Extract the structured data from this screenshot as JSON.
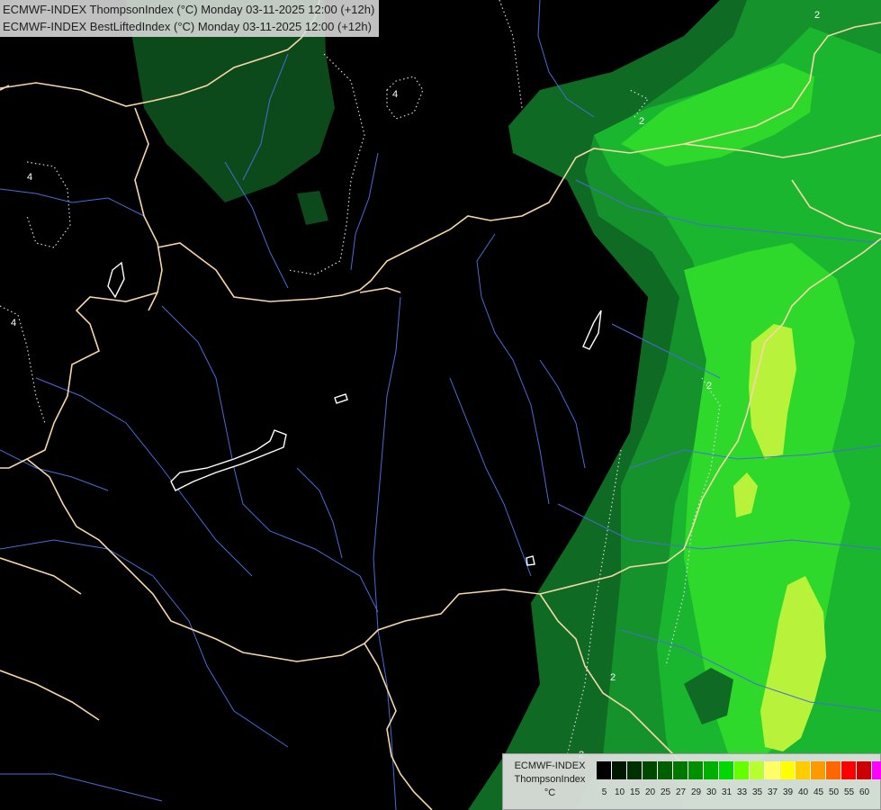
{
  "title": {
    "line1": "ECMWF-INDEX ThompsonIndex (°C) Monday 03-11-2025 12:00 (+12h)",
    "line2": "ECMWF-INDEX BestLiftedIndex (°C) Monday 03-11-2025 12:00 (+12h)"
  },
  "contour_labels": [
    "4",
    "4",
    "4",
    "2",
    "2",
    "2",
    "2",
    "2"
  ],
  "legend": {
    "line1": "ECMWF-INDEX",
    "line2": "ThompsonIndex",
    "line3": "°C",
    "colors": [
      "#000000",
      "#001800",
      "#003000",
      "#004800",
      "#006000",
      "#007800",
      "#009000",
      "#00b000",
      "#00d800",
      "#66ff00",
      "#b8ff30",
      "#ffff66",
      "#ffff00",
      "#ffcc00",
      "#ff9900",
      "#ff6600",
      "#ff0000",
      "#cc0000",
      "#ff00ff",
      "#cc00ff",
      "#9900ff",
      "#6600ff",
      "#0000ff"
    ],
    "ticks": [
      "5",
      "10",
      "15",
      "20",
      "25",
      "27",
      "29",
      "30",
      "31",
      "33",
      "35",
      "37",
      "39",
      "40",
      "45",
      "50",
      "55",
      "60"
    ]
  }
}
